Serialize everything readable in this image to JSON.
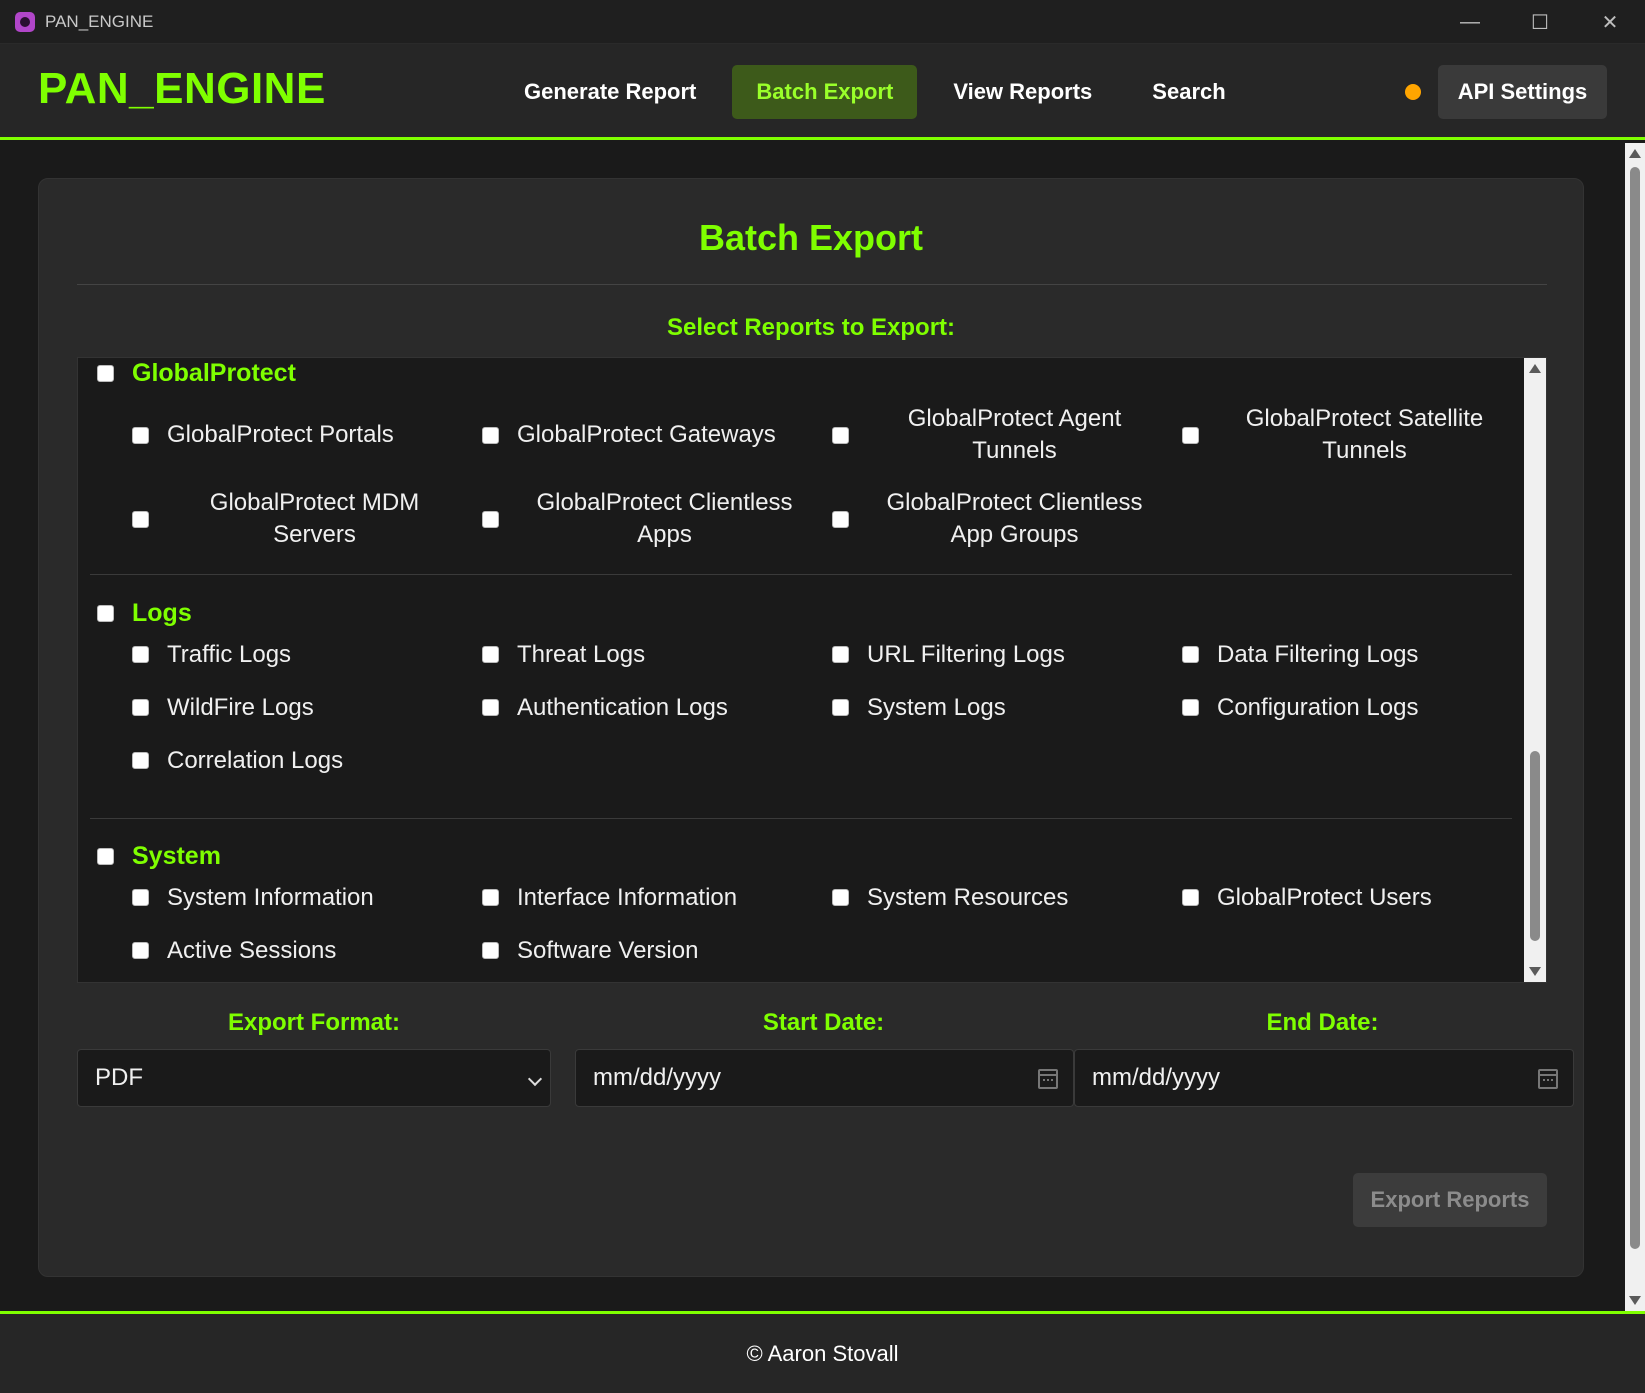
{
  "window": {
    "title": "PAN_ENGINE",
    "controls": {
      "minimize": "—",
      "maximize": "☐",
      "close": "✕"
    }
  },
  "header": {
    "brand": "PAN_ENGINE",
    "nav": [
      {
        "label": "Generate Report",
        "active": false
      },
      {
        "label": "Batch Export",
        "active": true
      },
      {
        "label": "View Reports",
        "active": false
      },
      {
        "label": "Search",
        "active": false
      }
    ],
    "status_color": "#ffa500",
    "api_settings_label": "API Settings"
  },
  "page": {
    "title": "Batch Export",
    "select_label": "Select Reports to Export:"
  },
  "groups": [
    {
      "name": "GlobalProtect",
      "items": [
        "GlobalProtect Portals",
        "GlobalProtect Gateways",
        "GlobalProtect Agent Tunnels",
        "GlobalProtect Satellite Tunnels",
        "GlobalProtect MDM Servers",
        "GlobalProtect Clientless Apps",
        "GlobalProtect Clientless App Groups"
      ]
    },
    {
      "name": "Logs",
      "items": [
        "Traffic Logs",
        "Threat Logs",
        "URL Filtering Logs",
        "Data Filtering Logs",
        "WildFire Logs",
        "Authentication Logs",
        "System Logs",
        "Configuration Logs",
        "Correlation Logs"
      ]
    },
    {
      "name": "System",
      "items": [
        "System Information",
        "Interface Information",
        "System Resources",
        "GlobalProtect Users",
        "Active Sessions",
        "Software Version"
      ]
    }
  ],
  "form": {
    "export_format_label": "Export Format:",
    "export_format_value": "PDF",
    "start_date_label": "Start Date:",
    "start_date_placeholder": "mm/dd/yyyy",
    "end_date_label": "End Date:",
    "end_date_placeholder": "mm/dd/yyyy"
  },
  "export_button_label": "Export Reports",
  "footer": {
    "text": "© Aaron Stovall"
  },
  "colors": {
    "accent": "#7fff00",
    "background": "#1a1a1a",
    "panel": "#2a2a2a"
  }
}
